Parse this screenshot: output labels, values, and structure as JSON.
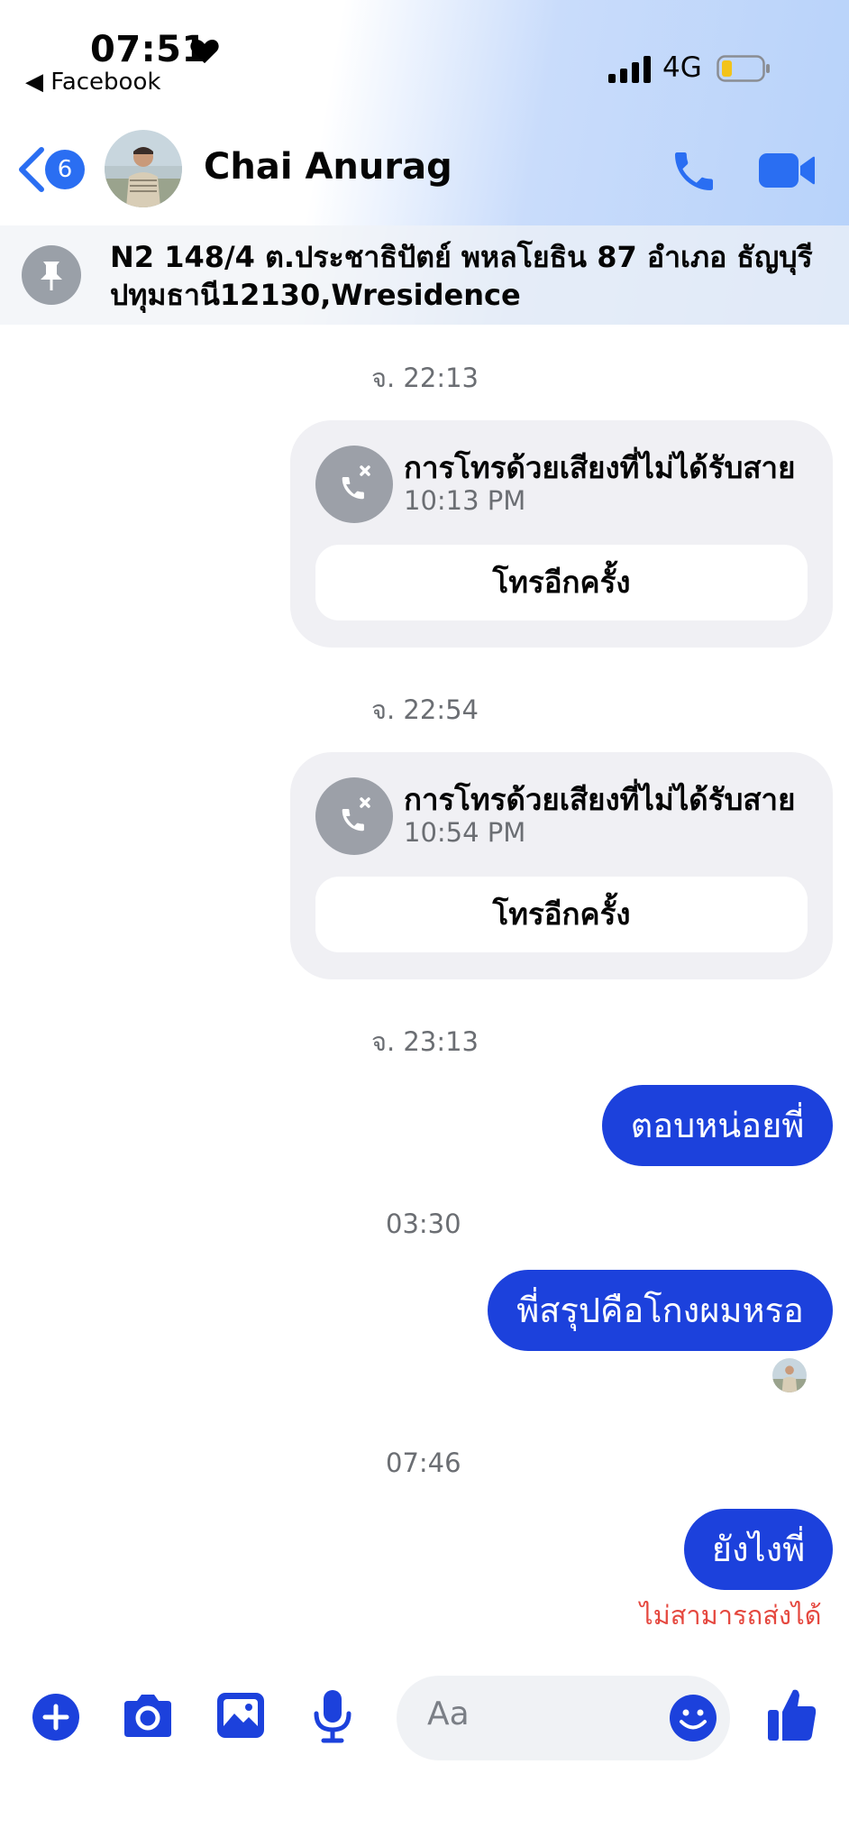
{
  "status_bar": {
    "time": "07:51",
    "back_app": "◀ Facebook",
    "network": "4G"
  },
  "header": {
    "unread_count": "6",
    "contact_name": "Chai Anurag"
  },
  "pinned": {
    "text": "N2 148/4 ต.ประชาธิปัตย์ พหลโยธิน 87 อำเภอ ธัญบุรี ปทุมธานี12130,Wresidence"
  },
  "messages": {
    "ts1": "จ. 22:13",
    "call1": {
      "title": "การโทรด้วยเสียงที่ไม่ได้รับสาย",
      "time": "10:13 PM",
      "action": "โทรอีกครั้ง"
    },
    "ts2": "จ. 22:54",
    "call2": {
      "title": "การโทรด้วยเสียงที่ไม่ได้รับสาย",
      "time": "10:54 PM",
      "action": "โทรอีกครั้ง"
    },
    "ts3": "จ. 23:13",
    "msg1": "ตอบหน่อยพี่",
    "ts4": "03:30",
    "msg2": "พี่สรุปคือโกงผมหรอ",
    "ts5": "07:46",
    "msg3": "ยังไงพี่",
    "fail_text": "ไม่สามารถส่งได้"
  },
  "composer": {
    "placeholder": "Aa"
  },
  "colors": {
    "accent": "#1c41dc",
    "header_icon": "#2a6ef2",
    "error": "#e5483f"
  },
  "icons": [
    "heart-icon",
    "signal-icon",
    "battery-icon",
    "back-chevron-icon",
    "phone-icon",
    "video-icon",
    "pin-icon",
    "missed-call-icon",
    "plus-icon",
    "camera-icon",
    "gallery-icon",
    "mic-icon",
    "emoji-icon",
    "like-icon"
  ]
}
